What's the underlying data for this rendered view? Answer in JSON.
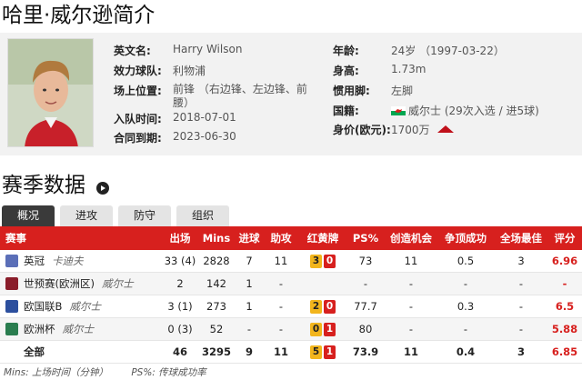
{
  "page_title": "哈里·威尔逊简介",
  "profile": {
    "english_name_label": "英文名:",
    "english_name": "Harry Wilson",
    "club_label": "效力球队:",
    "club": "利物浦",
    "position_label": "场上位置:",
    "position": "前锋 （右边锋、左边锋、前腰）",
    "joined_label": "入队时间:",
    "joined": "2018-07-01",
    "contract_label": "合同到期:",
    "contract": "2023-06-30",
    "age_label": "年龄:",
    "age": "24岁 （1997-03-22）",
    "height_label": "身高:",
    "height": "1.73m",
    "foot_label": "惯用脚:",
    "foot": "左脚",
    "nationality_label": "国籍:",
    "nationality": "威尔士 (29次入选 / 进5球)",
    "value_label": "身价(欧元):",
    "value": "1700万"
  },
  "section_title": "赛季数据",
  "tabs": [
    {
      "label": "概况"
    },
    {
      "label": "进攻"
    },
    {
      "label": "防守"
    },
    {
      "label": "组织"
    }
  ],
  "table": {
    "headers": [
      "赛事",
      "出场",
      "Mins",
      "进球",
      "助攻",
      "红黄牌",
      "PS%",
      "创造机会",
      "争顶成功",
      "全场最佳",
      "评分"
    ],
    "rows": [
      {
        "competition": "英冠",
        "team": "卡迪夫",
        "apps": "33 (4)",
        "mins": "2828",
        "goals": "7",
        "assists": "11",
        "yellow": "3",
        "red": "0",
        "ps": "73",
        "chances": "11",
        "aerial": "0.5",
        "motm": "3",
        "rating": "6.96",
        "icon": "#5b6fb8"
      },
      {
        "competition": "世预赛(欧洲区)",
        "team": "威尔士",
        "apps": "2",
        "mins": "142",
        "goals": "1",
        "assists": "-",
        "yellow": "",
        "red": "",
        "ps": "-",
        "chances": "-",
        "aerial": "-",
        "motm": "-",
        "rating": "-",
        "icon": "#8a1d2a"
      },
      {
        "competition": "欧国联B",
        "team": "威尔士",
        "apps": "3 (1)",
        "mins": "273",
        "goals": "1",
        "assists": "-",
        "yellow": "2",
        "red": "0",
        "ps": "77.7",
        "chances": "-",
        "aerial": "0.3",
        "motm": "-",
        "rating": "6.5",
        "icon": "#2c4f9e"
      },
      {
        "competition": "欧洲杯",
        "team": "威尔士",
        "apps": "0 (3)",
        "mins": "52",
        "goals": "-",
        "assists": "-",
        "yellow": "0",
        "red": "1",
        "ps": "80",
        "chances": "-",
        "aerial": "-",
        "motm": "-",
        "rating": "5.88",
        "icon": "#2a7d4f"
      }
    ],
    "total": {
      "label": "全部",
      "apps": "46",
      "mins": "3295",
      "goals": "9",
      "assists": "11",
      "yellow": "5",
      "red": "1",
      "ps": "73.9",
      "chances": "11",
      "aerial": "0.4",
      "motm": "3",
      "rating": "6.85"
    }
  },
  "legend": {
    "mins": "Mins: 上场时间（分钟）",
    "ps": "PS%: 传球成功率"
  }
}
